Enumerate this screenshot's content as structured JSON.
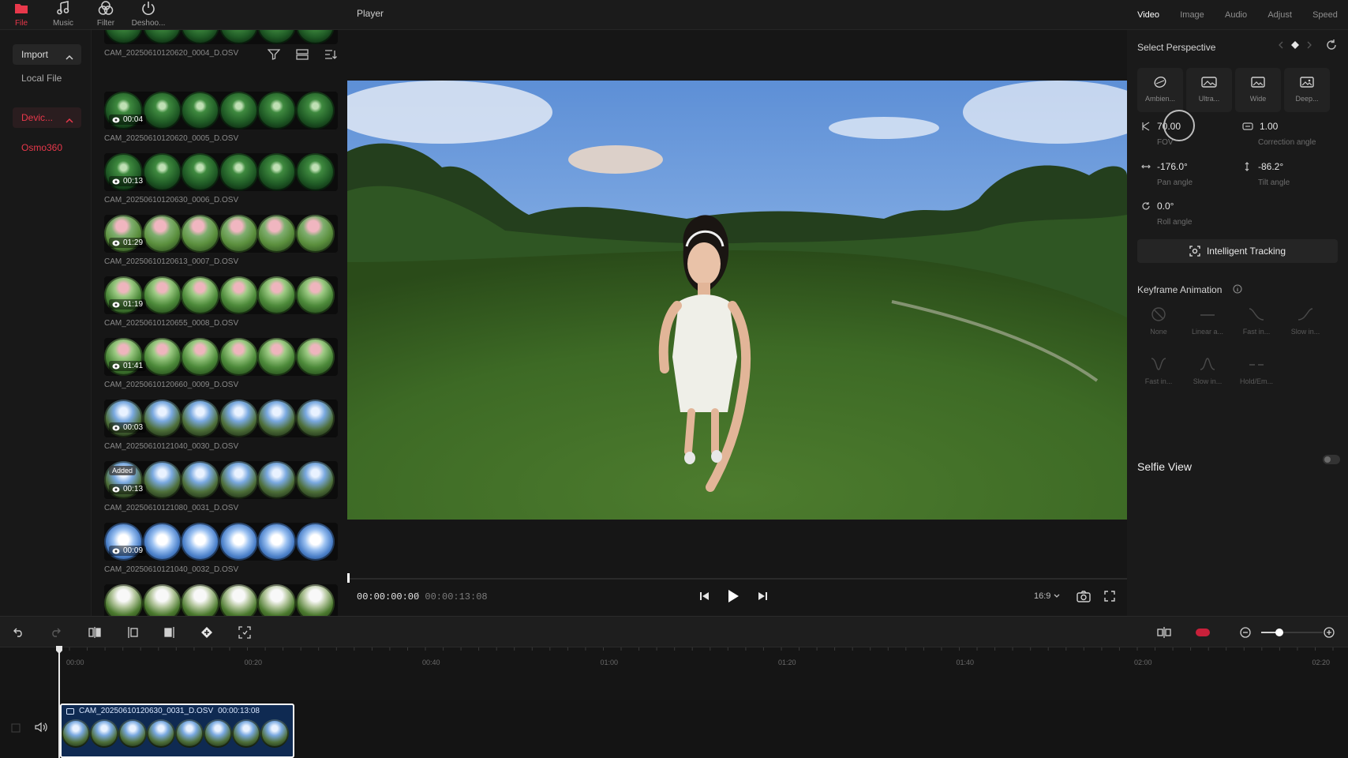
{
  "top_tabs": [
    {
      "label": "File",
      "icon": "folder-icon",
      "active": true
    },
    {
      "label": "Music",
      "icon": "music-note-icon",
      "active": false
    },
    {
      "label": "Filter",
      "icon": "filter-circles-icon",
      "active": false
    },
    {
      "label": "Deshoo...",
      "icon": "power-icon",
      "active": false
    }
  ],
  "left_nav": {
    "import_label": "Import",
    "local_file_label": "Local File",
    "folder_label": "Devic...",
    "folder_item_label": "Osmo360"
  },
  "media_items": [
    {
      "name": "CAM_20250610120620_0004_D.OSV",
      "duration": "",
      "tag": "",
      "style": "green"
    },
    {
      "name": "CAM_20250610120620_0005_D.OSV",
      "duration": "00:04",
      "tag": "",
      "style": "green"
    },
    {
      "name": "CAM_20250610120630_0006_D.OSV",
      "duration": "00:13",
      "tag": "",
      "style": "green"
    },
    {
      "name": "CAM_20250610120613_0007_D.OSV",
      "duration": "01:29",
      "tag": "",
      "style": "pink"
    },
    {
      "name": "CAM_20250610120655_0008_D.OSV",
      "duration": "01:19",
      "tag": "",
      "style": "pinkg"
    },
    {
      "name": "CAM_20250610120660_0009_D.OSV",
      "duration": "01:41",
      "tag": "",
      "style": "pinkg"
    },
    {
      "name": "CAM_20250610121040_0030_D.OSV",
      "duration": "00:03",
      "tag": "",
      "style": "sky"
    },
    {
      "name": "CAM_20250610121080_0031_D.OSV",
      "duration": "00:13",
      "tag": "Added",
      "style": "sky"
    },
    {
      "name": "CAM_20250610121040_0032_D.OSV",
      "duration": "00:09",
      "tag": "",
      "style": "cloud"
    },
    {
      "name": "",
      "duration": "",
      "tag": "",
      "style": "pale"
    }
  ],
  "player": {
    "title": "Player",
    "time_current": "00:00:00:00",
    "time_total": "/ 00:00:13:08",
    "aspect_ratio": "16:9",
    "progress": 0.0
  },
  "right_tabs": [
    {
      "label": "Video",
      "active": true
    },
    {
      "label": "Image",
      "active": false
    },
    {
      "label": "Audio",
      "active": false
    },
    {
      "label": "Adjust",
      "active": false
    },
    {
      "label": "Speed",
      "active": false
    }
  ],
  "perspective": {
    "title": "Select Perspective",
    "options": [
      {
        "label": "Ambien...",
        "icon": "lens-icon"
      },
      {
        "label": "Ultra...",
        "icon": "image-wide-icon"
      },
      {
        "label": "Wide",
        "icon": "image-icon"
      },
      {
        "label": "Deep...",
        "icon": "image-deep-icon"
      }
    ],
    "params": {
      "fov": {
        "value": "70.00",
        "label": "FOV"
      },
      "distortion": {
        "value": "1.00",
        "label": "Correction angle"
      },
      "pan": {
        "value": "-176.0°",
        "label": "Pan angle"
      },
      "tilt": {
        "value": "-86.2°",
        "label": "Tilt angle"
      },
      "roll": {
        "value": "0.0°",
        "label": "Roll angle"
      }
    },
    "tracking_label": "Intelligent Tracking"
  },
  "keyframe": {
    "title": "Keyframe Animation",
    "options": [
      "None",
      "Linear a...",
      "Fast in...",
      "Slow in...",
      "Fast in...",
      "Slow in...",
      "Hold/Em..."
    ]
  },
  "selfie_view": {
    "label": "Selfie View",
    "enabled": false
  },
  "timeline": {
    "ticks": [
      "00:00",
      "00:20",
      "00:40",
      "01:00",
      "01:20",
      "01:40",
      "02:00",
      "02:20"
    ],
    "clip_name": "CAM_20250610120630_0031_D.OSV",
    "clip_duration": "00:00:13:08",
    "zoom_level": 0.3
  },
  "colors": {
    "accent": "#e8384b",
    "record": "#c8203a",
    "clip": "#0f2a52"
  }
}
